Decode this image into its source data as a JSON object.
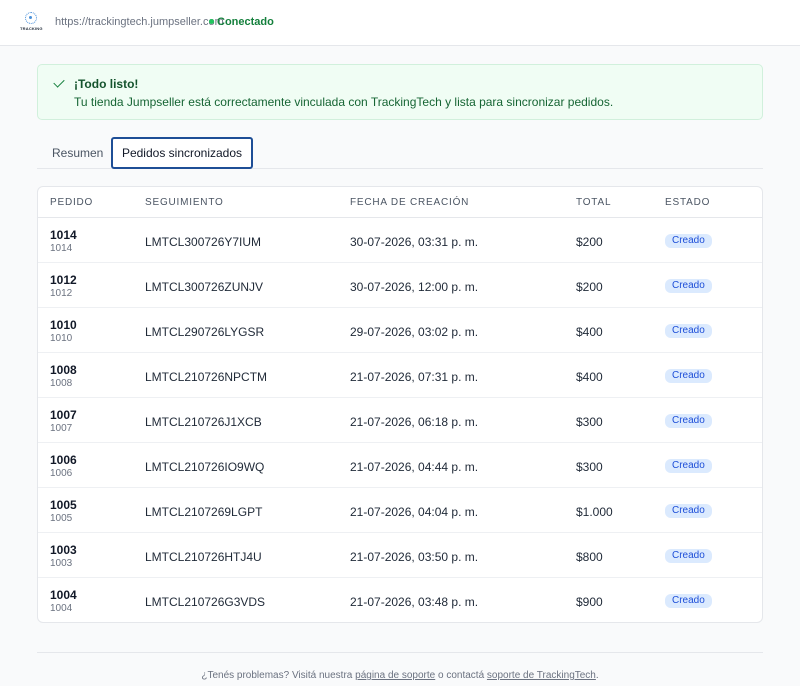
{
  "header": {
    "logo_text": "TRACKING",
    "store_url": "https://trackingtech.jumpseller.com",
    "status": "Conectado",
    "status_color": "#22c55e"
  },
  "alert": {
    "title": "¡Todo listo!",
    "message": "Tu tienda Jumpseller está correctamente vinculada con TrackingTech y lista para sincronizar pedidos."
  },
  "tabs": [
    {
      "label": "Resumen",
      "active": false
    },
    {
      "label": "Pedidos sincronizados",
      "active": true
    }
  ],
  "table": {
    "columns": [
      "PEDIDO",
      "SEGUIMIENTO",
      "FECHA DE CREACIÓN",
      "TOTAL",
      "ESTADO"
    ],
    "rows": [
      {
        "order": "1014",
        "order_sub": "1014",
        "tracking": "LMTCL300726Y7IUM",
        "date": "30-07-2026, 03:31 p. m.",
        "total": "$200",
        "status": "Creado"
      },
      {
        "order": "1012",
        "order_sub": "1012",
        "tracking": "LMTCL300726ZUNJV",
        "date": "30-07-2026, 12:00 p. m.",
        "total": "$200",
        "status": "Creado"
      },
      {
        "order": "1010",
        "order_sub": "1010",
        "tracking": "LMTCL290726LYGSR",
        "date": "29-07-2026, 03:02 p. m.",
        "total": "$400",
        "status": "Creado"
      },
      {
        "order": "1008",
        "order_sub": "1008",
        "tracking": "LMTCL210726NPCTM",
        "date": "21-07-2026, 07:31 p. m.",
        "total": "$400",
        "status": "Creado"
      },
      {
        "order": "1007",
        "order_sub": "1007",
        "tracking": "LMTCL210726J1XCB",
        "date": "21-07-2026, 06:18 p. m.",
        "total": "$300",
        "status": "Creado"
      },
      {
        "order": "1006",
        "order_sub": "1006",
        "tracking": "LMTCL210726IO9WQ",
        "date": "21-07-2026, 04:44 p. m.",
        "total": "$300",
        "status": "Creado"
      },
      {
        "order": "1005",
        "order_sub": "1005",
        "tracking": "LMTCL2107269LGPT",
        "date": "21-07-2026, 04:04 p. m.",
        "total": "$1.000",
        "status": "Creado"
      },
      {
        "order": "1003",
        "order_sub": "1003",
        "tracking": "LMTCL210726HTJ4U",
        "date": "21-07-2026, 03:50 p. m.",
        "total": "$800",
        "status": "Creado"
      },
      {
        "order": "1004",
        "order_sub": "1004",
        "tracking": "LMTCL210726G3VDS",
        "date": "21-07-2026, 03:48 p. m.",
        "total": "$900",
        "status": "Creado"
      }
    ]
  },
  "footer": {
    "text_before": "¿Tenés problemas? Visitá nuestra ",
    "link1": "página de soporte",
    "text_middle": " o contactá ",
    "link2": "soporte de TrackingTech",
    "text_after": "."
  }
}
